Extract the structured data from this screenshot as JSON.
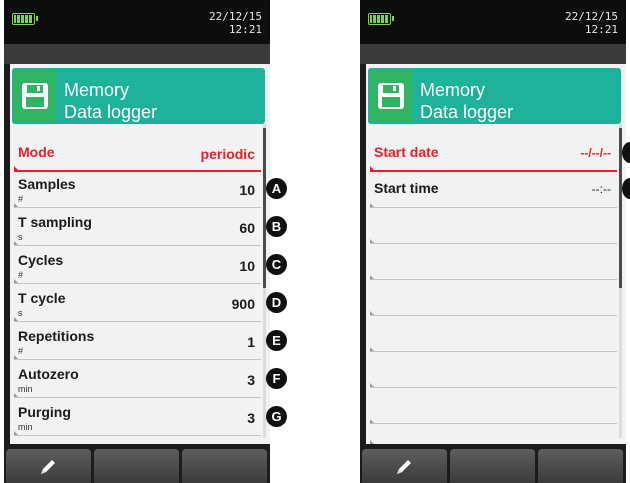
{
  "left": {
    "status": {
      "date": "22/12/15",
      "time": "12:21"
    },
    "header": {
      "title_line1": "Memory",
      "title_line2": "Data logger"
    },
    "rows": [
      {
        "label": "Mode",
        "unit": "",
        "value": "periodic",
        "badge": ""
      },
      {
        "label": "Samples",
        "unit": "#",
        "value": "10",
        "badge": "A"
      },
      {
        "label": "T sampling",
        "unit": "s",
        "value": "60",
        "badge": "B"
      },
      {
        "label": "Cycles",
        "unit": "#",
        "value": "10",
        "badge": "C"
      },
      {
        "label": "T cycle",
        "unit": "s",
        "value": "900",
        "badge": "D"
      },
      {
        "label": "Repetitions",
        "unit": "#",
        "value": "1",
        "badge": "E"
      },
      {
        "label": "Autozero",
        "unit": "min",
        "value": "3",
        "badge": "F"
      },
      {
        "label": "Purging",
        "unit": "min",
        "value": "3",
        "badge": "G"
      }
    ]
  },
  "right": {
    "status": {
      "date": "22/12/15",
      "time": "12:21"
    },
    "header": {
      "title_line1": "Memory",
      "title_line2": "Data logger"
    },
    "rows": [
      {
        "label": "Start date",
        "value": "--/--/--"
      },
      {
        "label": "Start time",
        "value": "--:--"
      }
    ]
  },
  "icons": {
    "battery": "battery-full-icon",
    "header": "floppy-disk-icon",
    "softkey": "pencil-edit-icon"
  },
  "colors": {
    "header_bg": "#1eb29a",
    "icon_bg": "#2fb561",
    "selection": "#e8202a",
    "battery": "#7dd44a"
  }
}
